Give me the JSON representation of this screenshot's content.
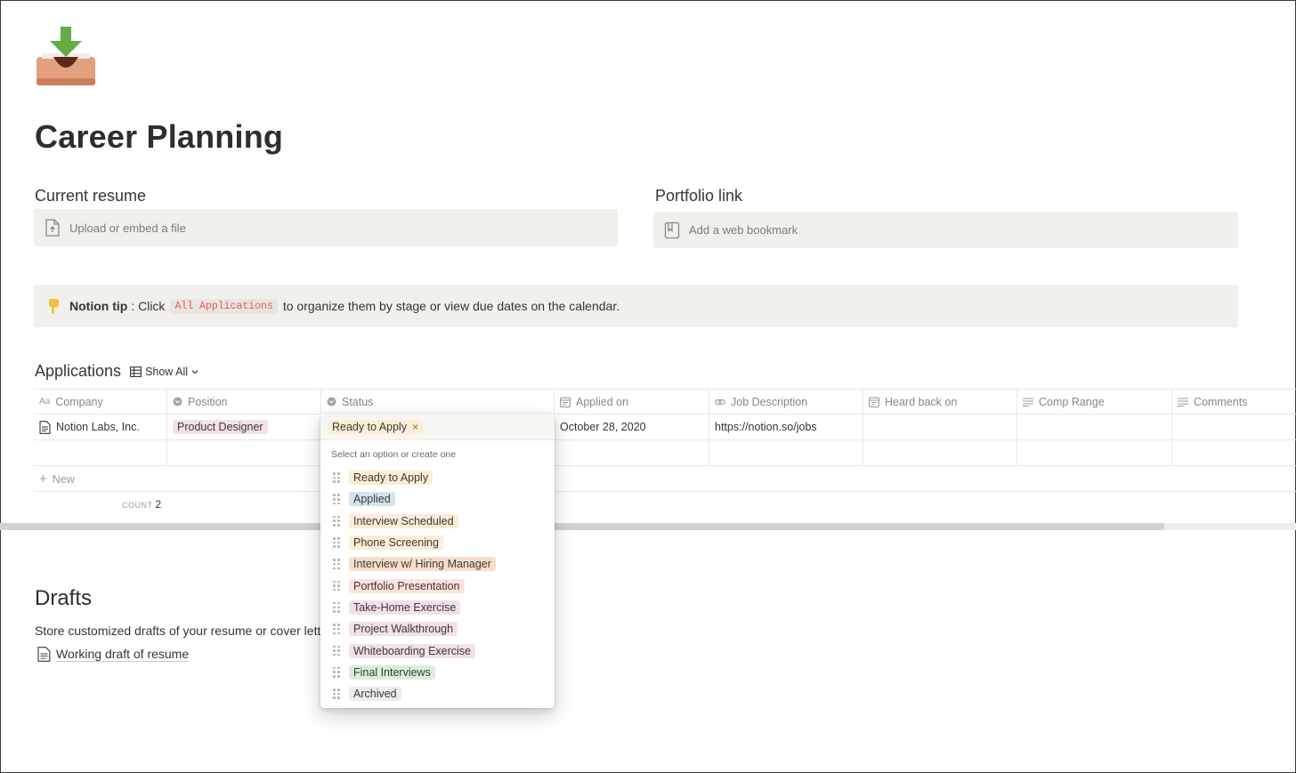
{
  "page": {
    "title": "Career Planning"
  },
  "resume": {
    "label": "Current resume",
    "placeholder": "Upload or embed a file"
  },
  "portfolio": {
    "label": "Portfolio link",
    "placeholder": "Add a web bookmark"
  },
  "callout": {
    "bold": "Notion tip",
    "pre": ": Click",
    "code": "All Applications",
    "post": "to organize them by stage or view due dates on the calendar."
  },
  "database": {
    "title": "Applications",
    "view": "Show All",
    "columns": [
      "Company",
      "Position",
      "Status",
      "Applied on",
      "Job Description",
      "Heard back on",
      "Comp Range",
      "Comments"
    ],
    "rows": [
      {
        "company": "Notion Labs, Inc.",
        "position": "Product Designer",
        "status": "Ready to Apply",
        "applied_on": "October 28, 2020",
        "job_description": "https://notion.so/jobs"
      }
    ],
    "new_label": "New",
    "count_label": "COUNT",
    "count_value": "2"
  },
  "dropdown": {
    "selected": "Ready to Apply",
    "remove": "×",
    "hint": "Select an option or create one",
    "options": [
      "Ready to Apply",
      "Applied",
      "Interview Scheduled",
      "Phone Screening",
      "Interview w/ Hiring Manager",
      "Portfolio Presentation",
      "Take-Home Exercise",
      "Project Walkthrough",
      "Whiteboarding Exercise",
      "Final Interviews",
      "Archived"
    ]
  },
  "drafts": {
    "title": "Drafts",
    "desc": "Store customized drafts of your resume or cover letter",
    "link": "Working draft of resume"
  },
  "colors": {
    "accent_code": "#eb5757",
    "block_bg": "#f1f0ec",
    "icon_green": "#5fa845",
    "icon_tray": "#e8a584"
  }
}
